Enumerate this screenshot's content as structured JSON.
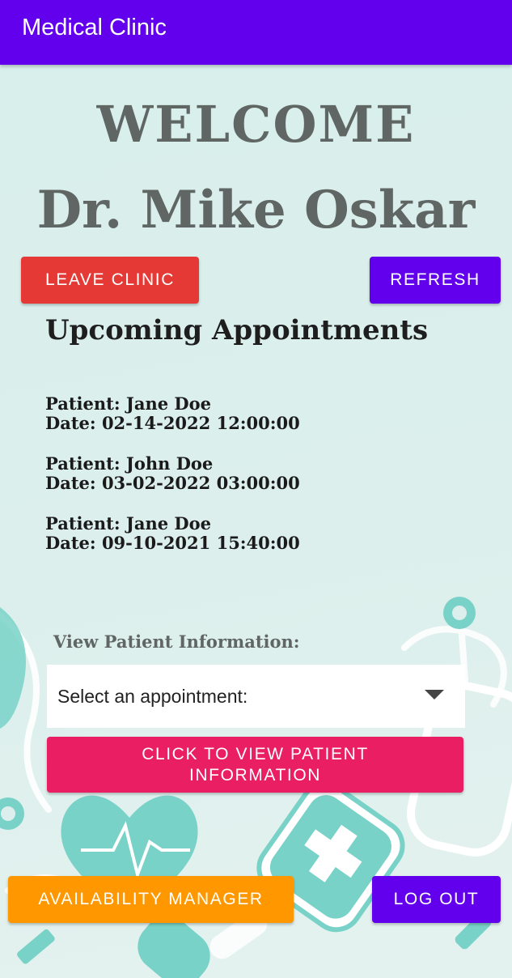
{
  "app_bar": {
    "title": "Medical Clinic"
  },
  "header": {
    "welcome": "WELCOME",
    "doctor_name": "Dr. Mike Oskar"
  },
  "actions": {
    "leave_clinic": "LEAVE CLINIC",
    "refresh": "REFRESH"
  },
  "appointments": {
    "title": "Upcoming Appointments",
    "items": [
      {
        "patient": "Patient: Jane Doe",
        "date": "Date: 02-14-2022 12:00:00"
      },
      {
        "patient": "Patient: John Doe",
        "date": "Date: 03-02-2022 03:00:00"
      },
      {
        "patient": "Patient: Jane Doe",
        "date": "Date: 09-10-2021 15:40:00"
      }
    ]
  },
  "patient_info": {
    "label": "View Patient Information:",
    "select_value": "Select an appointment:",
    "view_button": "CLICK TO VIEW PATIENT INFORMATION"
  },
  "footer": {
    "availability_manager": "AVAILABILITY MANAGER",
    "log_out": "LOG OUT"
  },
  "colors": {
    "primary": "#6200ee",
    "leave": "#e53935",
    "view": "#e91e63",
    "availability": "#ff9800",
    "art_teal": "#79d2c8"
  }
}
